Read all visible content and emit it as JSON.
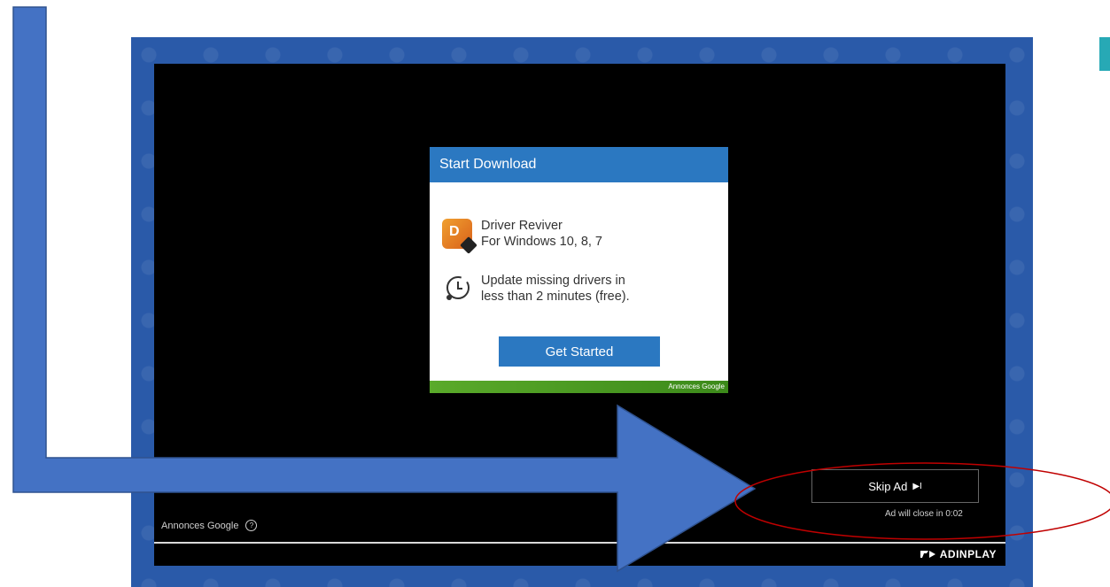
{
  "ad": {
    "header": "Start Download",
    "app_name": "Driver Reviver",
    "app_platforms": "For Windows 10, 8, 7",
    "description_line1": "Update missing drivers in",
    "description_line2": "less than 2 minutes (free).",
    "cta_label": "Get Started",
    "footer_label": "Annonces Google",
    "app_icon_letter": "D"
  },
  "player": {
    "annonces_label": "Annonces Google",
    "help_glyph": "?",
    "skip_label": "Skip Ad",
    "skip_glyph": "▶I",
    "close_note": "Ad will close in 0:02",
    "brand": "ADINPLAY"
  },
  "colors": {
    "frame_bg": "#2a5aa9",
    "ad_accent": "#2b78c1",
    "arrow": "#4472c4",
    "ellipse": "#c00000"
  }
}
